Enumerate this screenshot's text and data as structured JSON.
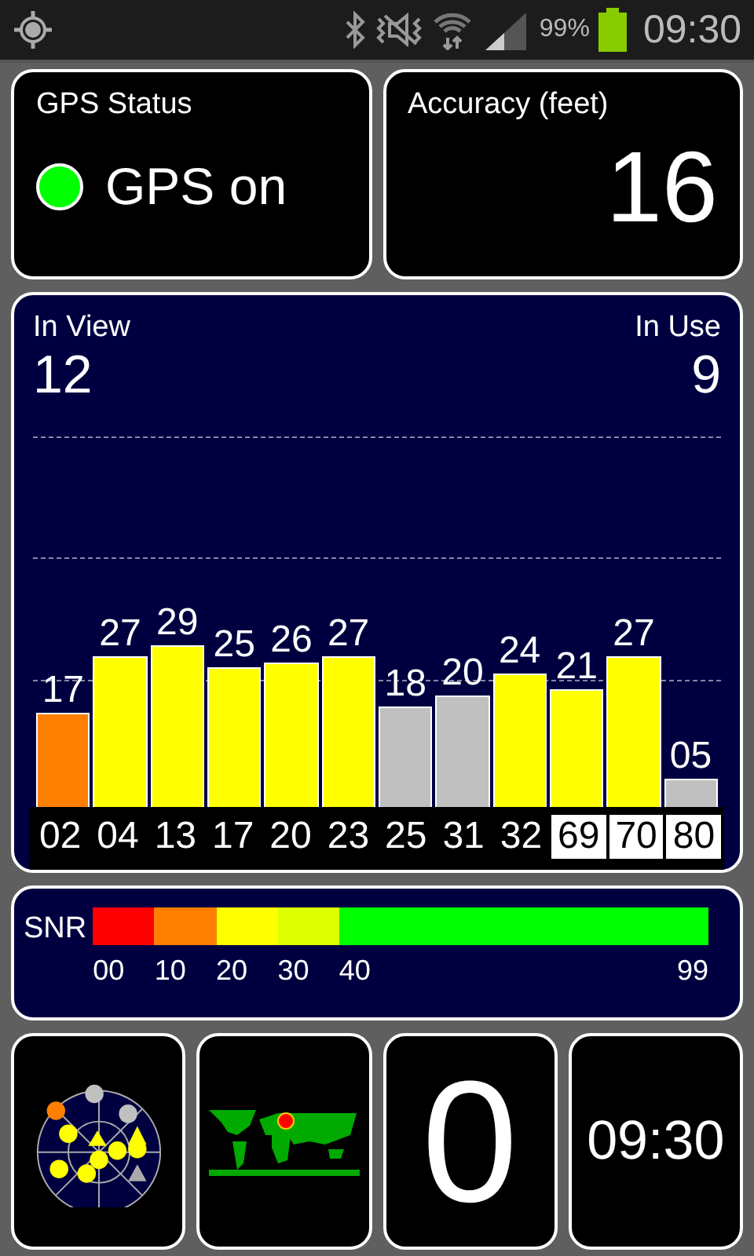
{
  "status_bar": {
    "battery_text": "99%",
    "time": "09:30"
  },
  "gps_status": {
    "title": "GPS Status",
    "text": "GPS on",
    "color": "#00ff00"
  },
  "accuracy": {
    "title": "Accuracy (feet)",
    "value": "16"
  },
  "satellites": {
    "in_view_label": "In View",
    "in_view": "12",
    "in_use_label": "In Use",
    "in_use": "9",
    "bars": [
      {
        "id": "02",
        "snr": "17",
        "color": "#ff8000",
        "highlighted": false
      },
      {
        "id": "04",
        "snr": "27",
        "color": "#ffff00",
        "highlighted": false
      },
      {
        "id": "13",
        "snr": "29",
        "color": "#ffff00",
        "highlighted": false
      },
      {
        "id": "17",
        "snr": "25",
        "color": "#ffff00",
        "highlighted": false
      },
      {
        "id": "20",
        "snr": "26",
        "color": "#ffff00",
        "highlighted": false
      },
      {
        "id": "23",
        "snr": "27",
        "color": "#ffff00",
        "highlighted": false
      },
      {
        "id": "25",
        "snr": "18",
        "color": "#c0c0c0",
        "highlighted": false
      },
      {
        "id": "31",
        "snr": "20",
        "color": "#c0c0c0",
        "highlighted": false
      },
      {
        "id": "32",
        "snr": "24",
        "color": "#ffff00",
        "highlighted": false
      },
      {
        "id": "69",
        "snr": "21",
        "color": "#ffff00",
        "highlighted": true
      },
      {
        "id": "70",
        "snr": "27",
        "color": "#ffff00",
        "highlighted": true
      },
      {
        "id": "80",
        "snr": "05",
        "color": "#c0c0c0",
        "highlighted": true
      }
    ]
  },
  "snr_legend": {
    "label": "SNR",
    "end_label": "99",
    "segments": [
      {
        "label": "00",
        "color": "#ff0000"
      },
      {
        "label": "10",
        "color": "#ff8000"
      },
      {
        "label": "20",
        "color": "#ffff00"
      },
      {
        "label": "30",
        "color": "#ddff00"
      },
      {
        "label": "40",
        "color": "#00ff00"
      }
    ]
  },
  "tiles": [
    {
      "kind": "radar"
    },
    {
      "kind": "map"
    },
    {
      "kind": "text",
      "value": "0"
    },
    {
      "kind": "clock",
      "value": "09:30"
    }
  ]
}
